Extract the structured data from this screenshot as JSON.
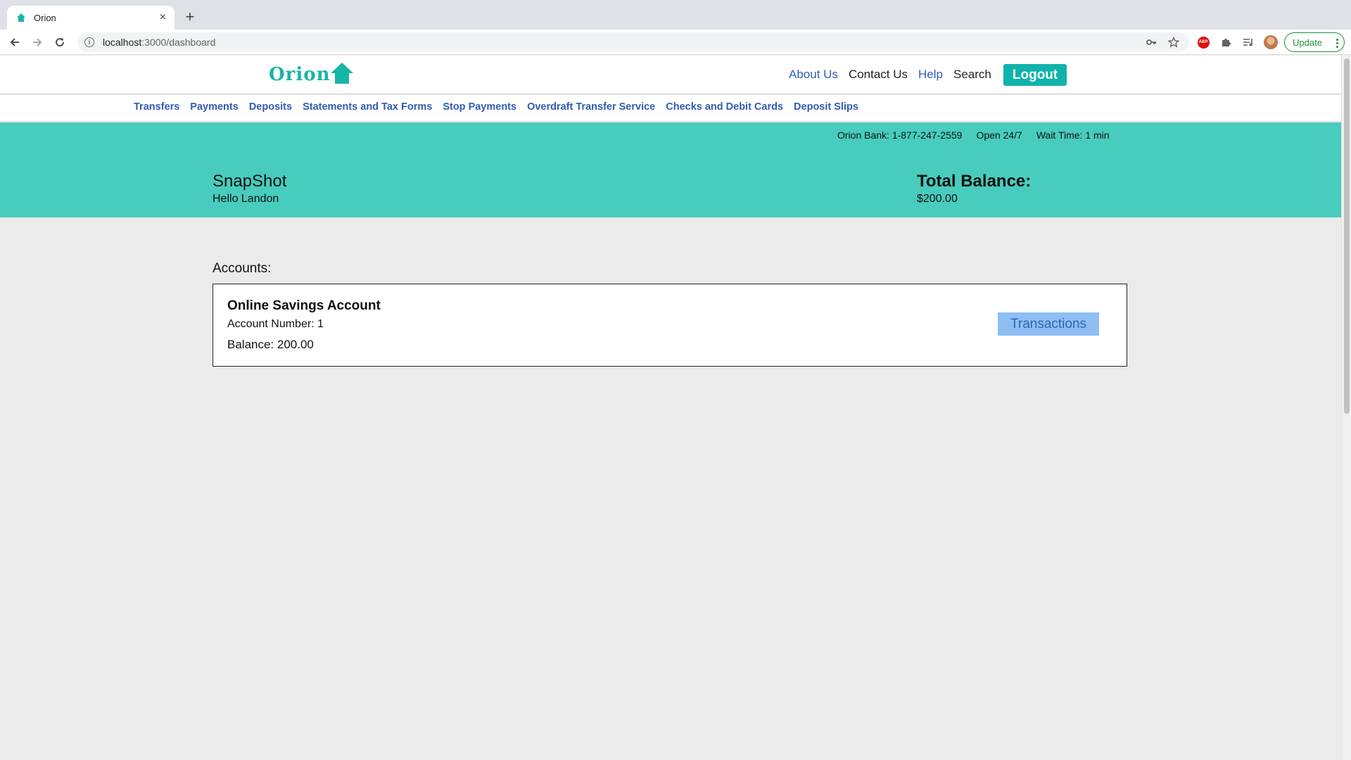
{
  "browser": {
    "tab_title": "Orion",
    "tab_close": "×",
    "new_tab": "+",
    "url_host": "localhost",
    "url_path": ":3000/dashboard",
    "update_label": "Update"
  },
  "header": {
    "logo_text": "Orion",
    "nav": [
      {
        "label": "About Us"
      },
      {
        "label": "Contact Us"
      },
      {
        "label": "Help"
      },
      {
        "label": "Search"
      }
    ],
    "logout_label": "Logout"
  },
  "subnav": {
    "items": [
      "Transfers",
      "Payments",
      "Deposits",
      "Statements and Tax Forms",
      "Stop Payments",
      "Overdraft Transfer Service",
      "Checks and Debit Cards",
      "Deposit Slips"
    ]
  },
  "hero": {
    "phone": "Orion Bank: 1-877-247-2559",
    "hours": "Open 24/7",
    "wait": "Wait Time: 1 min",
    "title": "SnapShot",
    "greeting": "Hello Landon",
    "total_label": "Total Balance:",
    "total_value": "$200.00"
  },
  "accounts": {
    "label": "Accounts:",
    "items": [
      {
        "name": "Online Savings Account",
        "number": "Account Number: 1",
        "balance": "Balance: 200.00",
        "button": "Transactions"
      }
    ]
  },
  "colors": {
    "brand_teal": "#17b5a6",
    "hero_bg": "#48ccbd",
    "logout_bg": "#10b3ac",
    "link_blue": "#2e5fb5",
    "transactions_bg": "#8dbff5"
  }
}
